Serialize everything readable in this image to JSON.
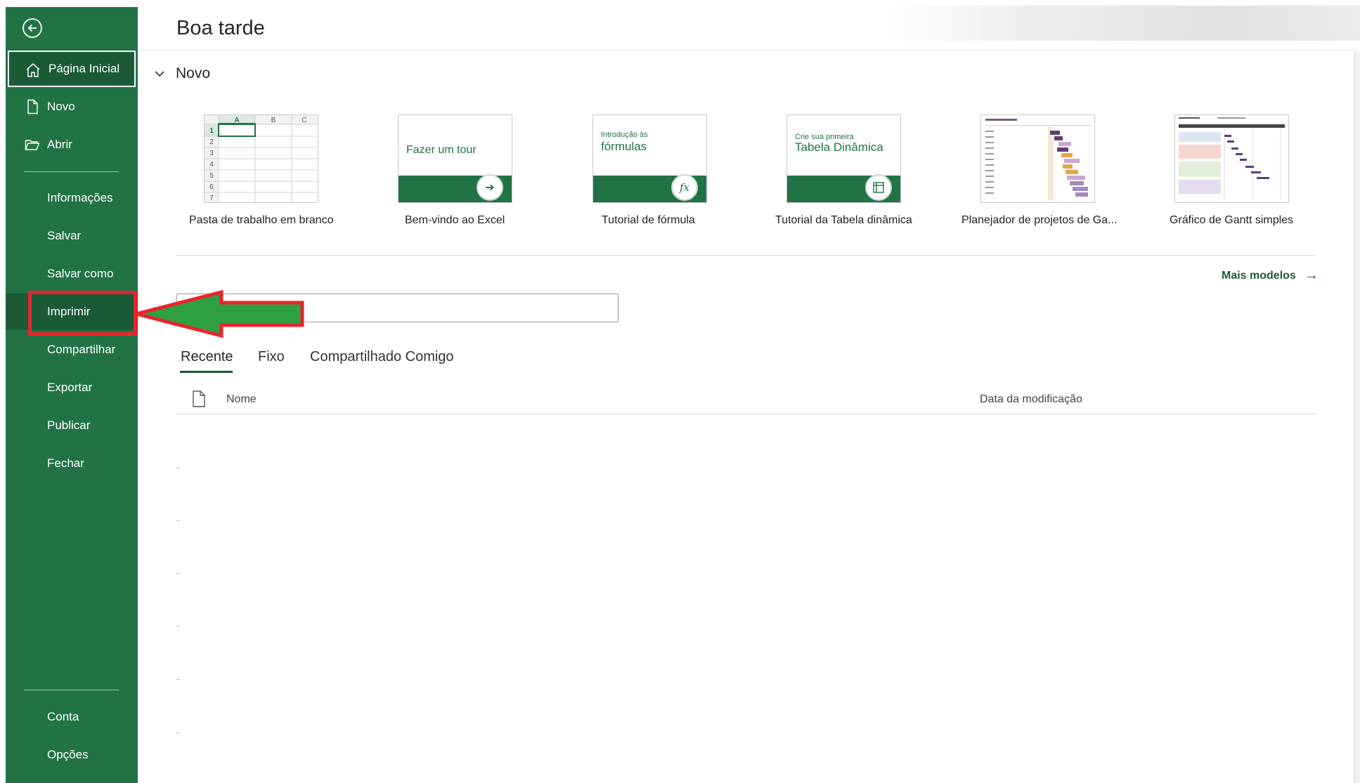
{
  "greeting": "Boa tarde",
  "sidebar": {
    "items": [
      {
        "id": "home",
        "label": "Página Inicial"
      },
      {
        "id": "novo",
        "label": "Novo"
      },
      {
        "id": "abrir",
        "label": "Abrir"
      },
      {
        "id": "informacoes",
        "label": "Informações"
      },
      {
        "id": "salvar",
        "label": "Salvar"
      },
      {
        "id": "salvar-como",
        "label": "Salvar como"
      },
      {
        "id": "imprimir",
        "label": "Imprimir"
      },
      {
        "id": "compartilhar",
        "label": "Compartilhar"
      },
      {
        "id": "exportar",
        "label": "Exportar"
      },
      {
        "id": "publicar",
        "label": "Publicar"
      },
      {
        "id": "fechar",
        "label": "Fechar"
      },
      {
        "id": "conta",
        "label": "Conta"
      },
      {
        "id": "opcoes",
        "label": "Opções"
      }
    ]
  },
  "novo_section": {
    "label": "Novo",
    "templates": [
      {
        "caption": "Pasta de trabalho em branco"
      },
      {
        "caption": "Bem-vindo ao Excel",
        "thumb_text": "Fazer um tour"
      },
      {
        "caption": "Tutorial de fórmula",
        "thumb_small": "Introdução às",
        "thumb_big": "fórmulas"
      },
      {
        "caption": "Tutorial da Tabela dinâmica",
        "thumb_small": "Crie sua primeira",
        "thumb_big": "Tabela Dinâmica"
      },
      {
        "caption": "Planejador de projetos de Ga..."
      },
      {
        "caption": "Gráfico de Gantt simples"
      }
    ],
    "blank_sheet": {
      "columns": [
        "A",
        "B",
        "C"
      ],
      "rows": [
        "1",
        "2",
        "3",
        "4",
        "5",
        "6",
        "7"
      ]
    },
    "more_label": "Mais modelos"
  },
  "tabs": [
    "Recente",
    "Fixo",
    "Compartilhado Comigo"
  ],
  "table": {
    "col_name": "Nome",
    "col_date": "Data da modificação"
  },
  "colors": {
    "brand": "#217346",
    "brand_dark": "#1a5a37",
    "highlight": "#e8252c",
    "arrow_fill": "#2ea043"
  }
}
